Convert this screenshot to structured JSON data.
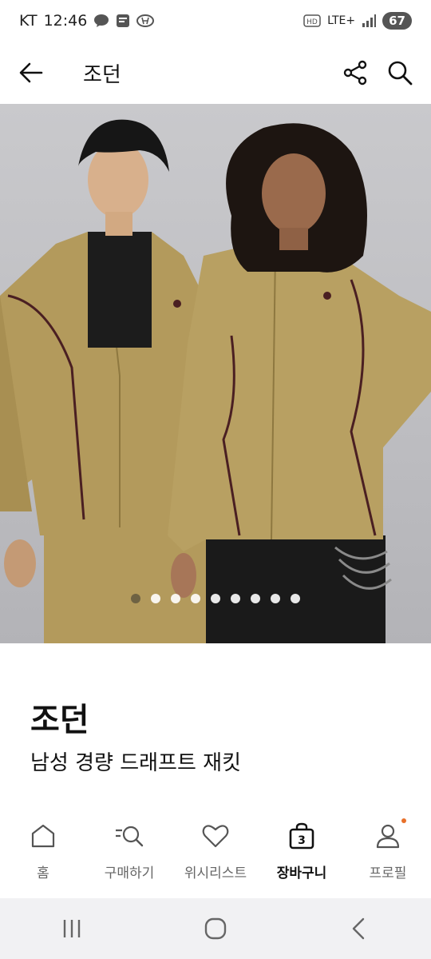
{
  "status_bar": {
    "carrier": "KT",
    "time": "12:46",
    "network": "LTE+",
    "battery": "67"
  },
  "app_bar": {
    "title": "조던"
  },
  "carousel": {
    "count": 9,
    "active_index": 0
  },
  "product": {
    "brand": "조던",
    "name": "남성 경량 드래프트 재킷"
  },
  "bottom_nav": {
    "items": [
      {
        "label": "홈",
        "icon": "home-icon"
      },
      {
        "label": "구매하기",
        "icon": "shop-search-icon"
      },
      {
        "label": "위시리스트",
        "icon": "heart-icon"
      },
      {
        "label": "장바구니",
        "icon": "bag-icon",
        "badge": "3"
      },
      {
        "label": "프로필",
        "icon": "profile-icon"
      }
    ]
  },
  "colors": {
    "jacket": "#b39a5c",
    "notification_dot": "#e8702a",
    "system_nav_bg": "#f1f1f3"
  }
}
